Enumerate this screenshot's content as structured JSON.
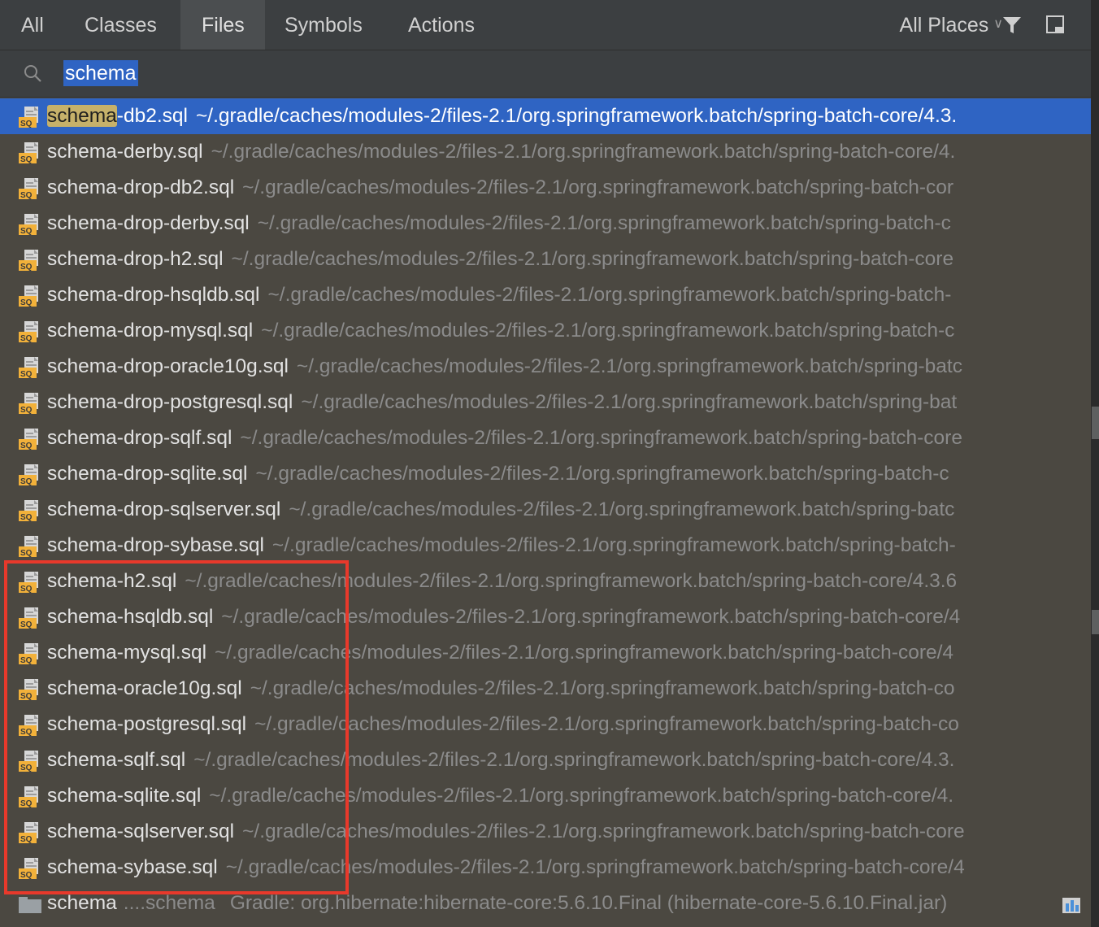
{
  "tabs": [
    {
      "label": "All",
      "active": false
    },
    {
      "label": "Classes",
      "active": false
    },
    {
      "label": "Files",
      "active": true
    },
    {
      "label": "Symbols",
      "active": false
    },
    {
      "label": "Actions",
      "active": false
    }
  ],
  "scope": {
    "label": "All Places"
  },
  "search": {
    "query": "schema"
  },
  "results": [
    {
      "name_match": "schema",
      "name_rest": "-db2.sql",
      "path": "~/.gradle/caches/modules-2/files-2.1/org.springframework.batch/spring-batch-core/4.3.",
      "selected": true
    },
    {
      "name_match": "schema",
      "name_rest": "-derby.sql",
      "path": "~/.gradle/caches/modules-2/files-2.1/org.springframework.batch/spring-batch-core/4.",
      "selected": false
    },
    {
      "name_match": "schema",
      "name_rest": "-drop-db2.sql",
      "path": "~/.gradle/caches/modules-2/files-2.1/org.springframework.batch/spring-batch-cor",
      "selected": false
    },
    {
      "name_match": "schema",
      "name_rest": "-drop-derby.sql",
      "path": "~/.gradle/caches/modules-2/files-2.1/org.springframework.batch/spring-batch-c",
      "selected": false
    },
    {
      "name_match": "schema",
      "name_rest": "-drop-h2.sql",
      "path": "~/.gradle/caches/modules-2/files-2.1/org.springframework.batch/spring-batch-core",
      "selected": false
    },
    {
      "name_match": "schema",
      "name_rest": "-drop-hsqldb.sql",
      "path": "~/.gradle/caches/modules-2/files-2.1/org.springframework.batch/spring-batch-",
      "selected": false
    },
    {
      "name_match": "schema",
      "name_rest": "-drop-mysql.sql",
      "path": "~/.gradle/caches/modules-2/files-2.1/org.springframework.batch/spring-batch-c",
      "selected": false
    },
    {
      "name_match": "schema",
      "name_rest": "-drop-oracle10g.sql",
      "path": "~/.gradle/caches/modules-2/files-2.1/org.springframework.batch/spring-batc",
      "selected": false
    },
    {
      "name_match": "schema",
      "name_rest": "-drop-postgresql.sql",
      "path": "~/.gradle/caches/modules-2/files-2.1/org.springframework.batch/spring-bat",
      "selected": false
    },
    {
      "name_match": "schema",
      "name_rest": "-drop-sqlf.sql",
      "path": "~/.gradle/caches/modules-2/files-2.1/org.springframework.batch/spring-batch-core",
      "selected": false
    },
    {
      "name_match": "schema",
      "name_rest": "-drop-sqlite.sql",
      "path": "~/.gradle/caches/modules-2/files-2.1/org.springframework.batch/spring-batch-c",
      "selected": false
    },
    {
      "name_match": "schema",
      "name_rest": "-drop-sqlserver.sql",
      "path": "~/.gradle/caches/modules-2/files-2.1/org.springframework.batch/spring-batc",
      "selected": false
    },
    {
      "name_match": "schema",
      "name_rest": "-drop-sybase.sql",
      "path": "~/.gradle/caches/modules-2/files-2.1/org.springframework.batch/spring-batch-",
      "selected": false
    },
    {
      "name_match": "schema",
      "name_rest": "-h2.sql",
      "path": "~/.gradle/caches/modules-2/files-2.1/org.springframework.batch/spring-batch-core/4.3.6",
      "selected": false
    },
    {
      "name_match": "schema",
      "name_rest": "-hsqldb.sql",
      "path": "~/.gradle/caches/modules-2/files-2.1/org.springframework.batch/spring-batch-core/4",
      "selected": false
    },
    {
      "name_match": "schema",
      "name_rest": "-mysql.sql",
      "path": "~/.gradle/caches/modules-2/files-2.1/org.springframework.batch/spring-batch-core/4",
      "selected": false
    },
    {
      "name_match": "schema",
      "name_rest": "-oracle10g.sql",
      "path": "~/.gradle/caches/modules-2/files-2.1/org.springframework.batch/spring-batch-co",
      "selected": false
    },
    {
      "name_match": "schema",
      "name_rest": "-postgresql.sql",
      "path": "~/.gradle/caches/modules-2/files-2.1/org.springframework.batch/spring-batch-co",
      "selected": false
    },
    {
      "name_match": "schema",
      "name_rest": "-sqlf.sql",
      "path": "~/.gradle/caches/modules-2/files-2.1/org.springframework.batch/spring-batch-core/4.3.",
      "selected": false
    },
    {
      "name_match": "schema",
      "name_rest": "-sqlite.sql",
      "path": "~/.gradle/caches/modules-2/files-2.1/org.springframework.batch/spring-batch-core/4.",
      "selected": false
    },
    {
      "name_match": "schema",
      "name_rest": "-sqlserver.sql",
      "path": "~/.gradle/caches/modules-2/files-2.1/org.springframework.batch/spring-batch-core",
      "selected": false
    },
    {
      "name_match": "schema",
      "name_rest": "-sybase.sql",
      "path": "~/.gradle/caches/modules-2/files-2.1/org.springframework.batch/spring-batch-core/4",
      "selected": false
    }
  ],
  "library_row": {
    "name": "schema",
    "sub": "....schema",
    "right": "Gradle: org.hibernate:hibernate-core:5.6.10.Final (hibernate-core-5.6.10.Final.jar)"
  },
  "colors": {
    "selection": "#2f64c3",
    "match_highlight": "#c6b16a",
    "annotation_box": "#e8392b"
  }
}
